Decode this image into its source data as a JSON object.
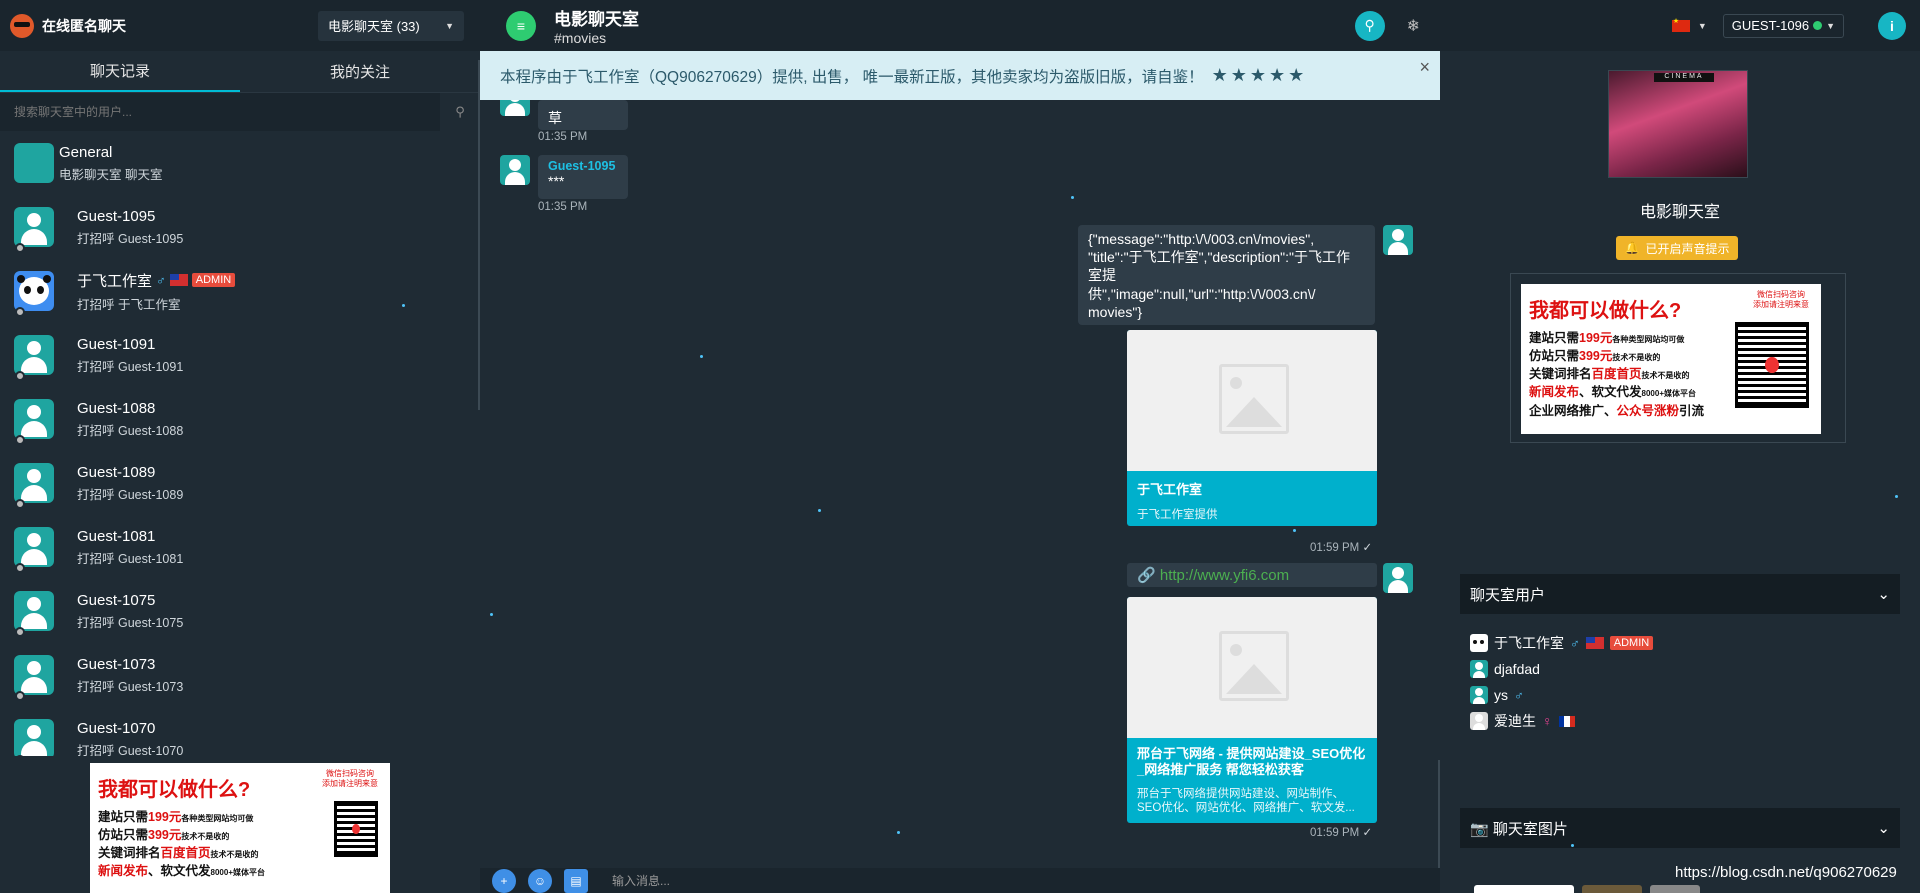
{
  "left": {
    "brand": "在线匿名聊天",
    "room_select": "电影聊天室 (33)",
    "tabs": [
      "聊天记录",
      "我的关注"
    ],
    "search_placeholder": "搜索聊天室中的用户...",
    "items": [
      {
        "name": "General",
        "sub": "电影聊天室 聊天室",
        "avatar": "cinema"
      },
      {
        "name": "Guest-1095",
        "sub": "打招呼 Guest-1095",
        "avatar": "person"
      },
      {
        "name": "于飞工作室",
        "sub": "打招呼 于飞工作室",
        "avatar": "panda",
        "badge": "ADMIN"
      },
      {
        "name": "Guest-1091",
        "sub": "打招呼 Guest-1091",
        "avatar": "person"
      },
      {
        "name": "Guest-1088",
        "sub": "打招呼 Guest-1088",
        "avatar": "person"
      },
      {
        "name": "Guest-1089",
        "sub": "打招呼 Guest-1089",
        "avatar": "person"
      },
      {
        "name": "Guest-1081",
        "sub": "打招呼 Guest-1081",
        "avatar": "person"
      },
      {
        "name": "Guest-1075",
        "sub": "打招呼 Guest-1075",
        "avatar": "person"
      },
      {
        "name": "Guest-1073",
        "sub": "打招呼 Guest-1073",
        "avatar": "person"
      },
      {
        "name": "Guest-1070",
        "sub": "打招呼 Guest-1070",
        "avatar": "person"
      }
    ]
  },
  "ad": {
    "title": "我都可以做什么?",
    "tag1": "微信扫码咨询",
    "tag2": "添加请注明来意",
    "line1_a": "建站只需",
    "line1_b": "199元",
    "line1_c": "各种类型网站均可做",
    "line2_a": "仿站只需",
    "line2_b": "399元",
    "line2_c": "技术不是收的",
    "line3_a": "关键词排名",
    "line3_b": "百度首页",
    "line3_c": "技术不是收的",
    "line4_a": "新闻发布",
    "line4_b": "、软文代发",
    "line4_c": "8000+媒体平台",
    "line5_a": "企业网络推广、",
    "line5_b": "公众号涨粉",
    "line5_c": "引流"
  },
  "mid": {
    "room_title": "电影聊天室",
    "room_slug": "#movies",
    "notice": "本程序由于飞工作室（QQ906270629）提供, 出售， 唯一最新正版，其他卖家均为盗版旧版，请自鉴！",
    "notice_stars": "★★★★★",
    "msg1_text": "草",
    "msg1_time": "01:35 PM",
    "msg2_author": "Guest-1095",
    "msg2_text": "***",
    "msg2_time": "01:35 PM",
    "msg3_lines": [
      "{\"message\":\"http:\\/\\/003.cn\\/movies\",",
      "\"title\":\"于飞工作室\",\"description\":\"于飞工作",
      "室提",
      "供\",\"image\":null,\"url\":\"http:\\/\\/003.cn\\/",
      "movies\"}"
    ],
    "card1_title": "于飞工作室",
    "card1_desc": "于飞工作室提供",
    "msg3_time": "01:59 PM",
    "link_text": "http://www.yfi6.com",
    "card2_title": "邢台于飞网络 - 提供网站建设_SEO优化_网络推广服务 帮您轻松获客",
    "card2_desc": "邢台于飞网络提供网站建设、网站制作、SEO优化、网站优化、网络推广、软文发...",
    "msg4_time": "01:59 PM",
    "composer_placeholder": "输入消息..."
  },
  "right": {
    "user_select": "GUEST-1096",
    "info_icon": "i",
    "room_sign": "CINEMA",
    "room_name": "电影聊天室",
    "sound_btn": "已开启声音提示",
    "users_panel": "聊天室用户",
    "users": [
      {
        "name": "于飞工作室",
        "avatar": "panda",
        "badge": "ADMIN"
      },
      {
        "name": "djafdad",
        "avatar": "person"
      },
      {
        "name": "ys",
        "avatar": "person",
        "gender": "♂"
      },
      {
        "name": "爱迪生",
        "avatar": "grey",
        "gender": "♀"
      }
    ],
    "images_panel": "聊天室图片"
  },
  "watermark": "https://blog.csdn.net/q906270629",
  "colors": {
    "accent": "#00bcd4",
    "admin": "#e74c3c",
    "green": "#2ecc71",
    "sound": "#f0b429"
  }
}
